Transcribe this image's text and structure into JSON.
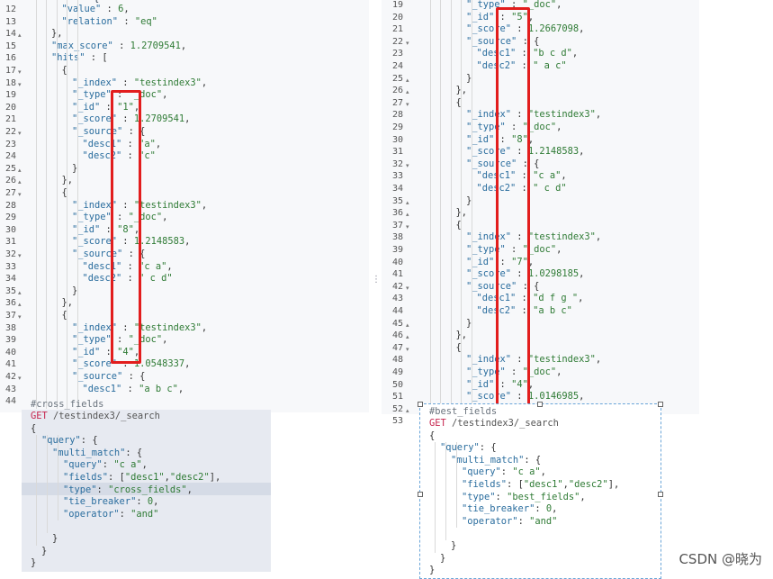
{
  "left_response": {
    "line_numbers": [
      "12",
      "13",
      "14",
      "15",
      "16",
      "17",
      "18",
      "19",
      "20",
      "21",
      "22",
      "23",
      "24",
      "25",
      "26",
      "27",
      "28",
      "29",
      "30",
      "31",
      "32",
      "33",
      "34",
      "35",
      "36",
      "37",
      "38",
      "39",
      "40",
      "41",
      "42",
      "43",
      "44"
    ],
    "fold_markers": [
      "",
      "",
      "▴",
      "",
      "",
      "▾",
      "▾",
      "",
      "",
      "",
      "▾",
      "",
      "",
      "▴",
      "▴",
      "▾",
      "",
      "",
      "",
      "",
      "▾",
      "",
      "",
      "▴",
      "▴",
      "▾",
      "",
      "",
      "",
      "",
      "▾",
      "",
      ""
    ],
    "lines": [
      {
        "indent": 3,
        "text": "\"value\" : 6,"
      },
      {
        "indent": 3,
        "text": "\"relation\" : \"eq\""
      },
      {
        "indent": 2,
        "text": "},"
      },
      {
        "indent": 2,
        "text": "\"max_score\" : 1.2709541,"
      },
      {
        "indent": 2,
        "text": "\"hits\" : ["
      },
      {
        "indent": 3,
        "text": "{"
      },
      {
        "indent": 4,
        "text": "\"_index\" : \"testindex3\","
      },
      {
        "indent": 4,
        "text": "\"_type\" : \"_doc\","
      },
      {
        "indent": 4,
        "text": "\"_id\" : \"1\","
      },
      {
        "indent": 4,
        "text": "\"_score\" : 1.2709541,"
      },
      {
        "indent": 4,
        "text": "\"_source\" : {"
      },
      {
        "indent": 5,
        "text": "\"desc1\" : \"a\","
      },
      {
        "indent": 5,
        "text": "\"desc2\" : \"c\""
      },
      {
        "indent": 4,
        "text": "}"
      },
      {
        "indent": 3,
        "text": "},"
      },
      {
        "indent": 3,
        "text": "{"
      },
      {
        "indent": 4,
        "text": "\"_index\" : \"testindex3\","
      },
      {
        "indent": 4,
        "text": "\"_type\" : \"_doc\","
      },
      {
        "indent": 4,
        "text": "\"_id\" : \"8\","
      },
      {
        "indent": 4,
        "text": "\"_score\" : 1.2148583,"
      },
      {
        "indent": 4,
        "text": "\"_source\" : {"
      },
      {
        "indent": 5,
        "text": "\"desc1\" : \"c a\","
      },
      {
        "indent": 5,
        "text": "\"desc2\" : \" c d\""
      },
      {
        "indent": 4,
        "text": "}"
      },
      {
        "indent": 3,
        "text": "},"
      },
      {
        "indent": 3,
        "text": "{"
      },
      {
        "indent": 4,
        "text": "\"_index\" : \"testindex3\","
      },
      {
        "indent": 4,
        "text": "\"_type\" : \"_doc\","
      },
      {
        "indent": 4,
        "text": "\"_id\" : \"4\","
      },
      {
        "indent": 4,
        "text": "\"_score\" : 1.0548337,"
      },
      {
        "indent": 4,
        "text": "\"_source\" : {"
      },
      {
        "indent": 5,
        "text": "\"desc1\" : \"a b c\","
      },
      {
        "indent": 5,
        "text": ""
      }
    ]
  },
  "right_response": {
    "line_numbers": [
      "19",
      "20",
      "21",
      "22",
      "23",
      "24",
      "25",
      "26",
      "27",
      "28",
      "29",
      "30",
      "31",
      "32",
      "33",
      "34",
      "35",
      "36",
      "37",
      "38",
      "39",
      "40",
      "41",
      "42",
      "43",
      "44",
      "45",
      "46",
      "47",
      "48",
      "49",
      "50",
      "51",
      "52",
      "53"
    ],
    "fold_markers": [
      "",
      "",
      "",
      "▾",
      "",
      "",
      "▴",
      "▴",
      "▾",
      "",
      "",
      "",
      "",
      "▾",
      "",
      "",
      "▴",
      "▴",
      "▾",
      "",
      "",
      "",
      "",
      "▾",
      "",
      "",
      "▴",
      "▴",
      "▾",
      "",
      "",
      "",
      "",
      "▴",
      ""
    ],
    "lines": [
      {
        "indent": 4,
        "text": "\"_type\" : \"_doc\","
      },
      {
        "indent": 4,
        "text": "\"_id\" : \"5\","
      },
      {
        "indent": 4,
        "text": "\"_score\" : 1.2667098,"
      },
      {
        "indent": 4,
        "text": "\"_source\" : {"
      },
      {
        "indent": 5,
        "text": "\"desc1\" : \"b c d\","
      },
      {
        "indent": 5,
        "text": "\"desc2\" : \" a c\""
      },
      {
        "indent": 4,
        "text": "}"
      },
      {
        "indent": 3,
        "text": "},"
      },
      {
        "indent": 3,
        "text": "{"
      },
      {
        "indent": 4,
        "text": "\"_index\" : \"testindex3\","
      },
      {
        "indent": 4,
        "text": "\"_type\" : \"_doc\","
      },
      {
        "indent": 4,
        "text": "\"_id\" : \"8\","
      },
      {
        "indent": 4,
        "text": "\"_score\" : 1.2148583,"
      },
      {
        "indent": 4,
        "text": "\"_source\" : {"
      },
      {
        "indent": 5,
        "text": "\"desc1\" : \"c a\","
      },
      {
        "indent": 5,
        "text": "\"desc2\" : \" c d\""
      },
      {
        "indent": 4,
        "text": "}"
      },
      {
        "indent": 3,
        "text": "},"
      },
      {
        "indent": 3,
        "text": "{"
      },
      {
        "indent": 4,
        "text": "\"_index\" : \"testindex3\","
      },
      {
        "indent": 4,
        "text": "\"_type\" : \"_doc\","
      },
      {
        "indent": 4,
        "text": "\"_id\" : \"7\","
      },
      {
        "indent": 4,
        "text": "\"_score\" : 1.0298185,"
      },
      {
        "indent": 4,
        "text": "\"_source\" : {"
      },
      {
        "indent": 5,
        "text": "\"desc1\" : \"d f g \","
      },
      {
        "indent": 5,
        "text": "\"desc2\" : \"a b c\""
      },
      {
        "indent": 4,
        "text": "}"
      },
      {
        "indent": 3,
        "text": "},"
      },
      {
        "indent": 3,
        "text": "{"
      },
      {
        "indent": 4,
        "text": "\"_index\" : \"testindex3\","
      },
      {
        "indent": 4,
        "text": "\"_type\" : \"_doc\","
      },
      {
        "indent": 4,
        "text": "\"_id\" : \"4\","
      },
      {
        "indent": 4,
        "text": "\"_score\" : 1.0146985,"
      },
      {
        "indent": 0,
        "text": ""
      },
      {
        "indent": 0,
        "text": ""
      }
    ]
  },
  "left_request": {
    "comment": "#cross_fields",
    "method": "GET",
    "path": "/testindex3/_search",
    "lines": [
      {
        "indent": 0,
        "text": "{"
      },
      {
        "indent": 1,
        "text": "\"query\": {"
      },
      {
        "indent": 2,
        "text": "\"multi_match\": {"
      },
      {
        "indent": 3,
        "text": "\"query\": \"c a\","
      },
      {
        "indent": 3,
        "text": "\"fields\": [\"desc1\",\"desc2\"],"
      },
      {
        "indent": 3,
        "text": "\"type\": \"cross_fields\","
      },
      {
        "indent": 3,
        "text": "\"tie_breaker\": 0,"
      },
      {
        "indent": 3,
        "text": "\"operator\": \"and\""
      },
      {
        "indent": 0,
        "text": ""
      },
      {
        "indent": 2,
        "text": "}"
      },
      {
        "indent": 1,
        "text": "}"
      },
      {
        "indent": 0,
        "text": "}"
      }
    ]
  },
  "right_request": {
    "comment": "#best_fields",
    "method": "GET",
    "path": "/testindex3/_search",
    "lines": [
      {
        "indent": 0,
        "text": "{"
      },
      {
        "indent": 1,
        "text": "\"query\": {"
      },
      {
        "indent": 2,
        "text": "\"multi_match\": {"
      },
      {
        "indent": 3,
        "text": "\"query\": \"c a\","
      },
      {
        "indent": 3,
        "text": "\"fields\": [\"desc1\",\"desc2\"],"
      },
      {
        "indent": 3,
        "text": "\"type\": \"best_fields\","
      },
      {
        "indent": 3,
        "text": "\"tie_breaker\": 0,"
      },
      {
        "indent": 3,
        "text": "\"operator\": \"and\""
      },
      {
        "indent": 0,
        "text": ""
      },
      {
        "indent": 2,
        "text": "}"
      },
      {
        "indent": 1,
        "text": "}"
      },
      {
        "indent": 0,
        "text": "}"
      }
    ]
  },
  "partial_top_text": {
    "left": "{",
    "right": "\"_type\" : \"_doc\","
  },
  "watermark": "CSDN @晓为",
  "colors": {
    "highlight_box": "#e21d1d",
    "key": "#2a6d9e",
    "string": "#2f7b35",
    "method": "#c7254e"
  }
}
